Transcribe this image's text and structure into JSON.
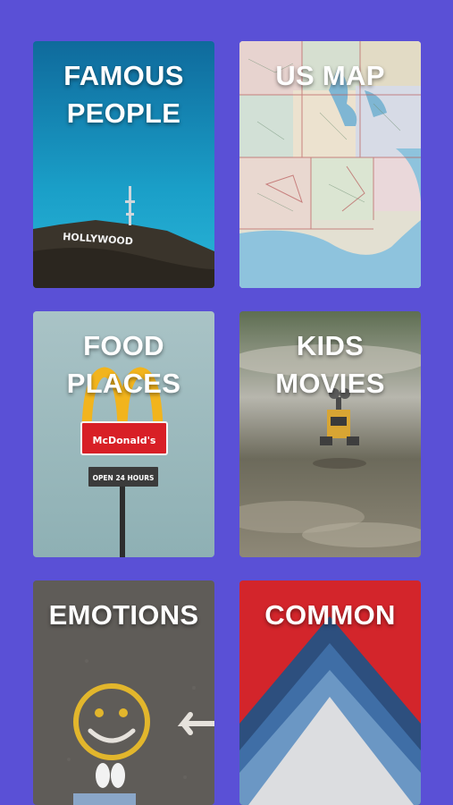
{
  "categories": [
    {
      "label": "FAMOUS\nPEOPLE",
      "image_text": "HOLLYWOOD"
    },
    {
      "label": "US MAP"
    },
    {
      "label": "FOOD\nPLACES",
      "image_text": "McDonald's",
      "image_subtext": "OPEN 24 HOURS"
    },
    {
      "label": "KIDS\nMOVIES"
    },
    {
      "label": "EMOTIONS"
    },
    {
      "label": "COMMON"
    }
  ],
  "colors": {
    "background": "#5a50d6",
    "label": "#ffffff"
  }
}
